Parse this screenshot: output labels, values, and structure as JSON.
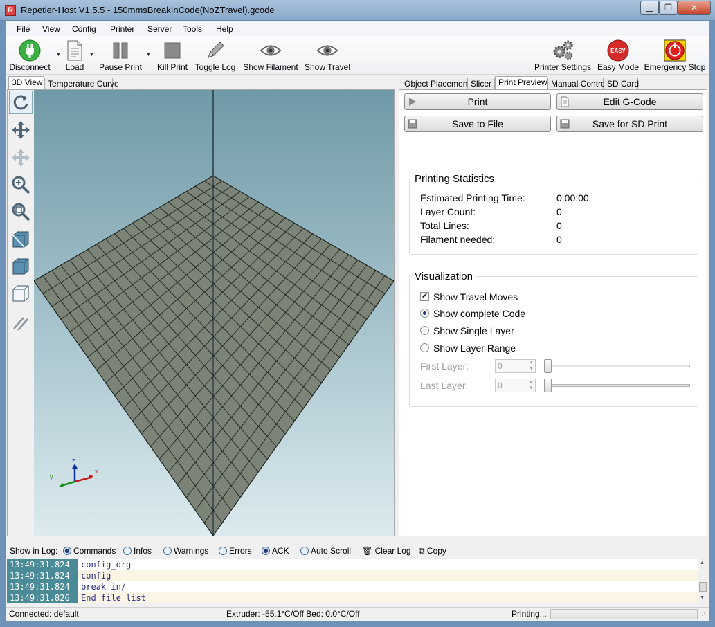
{
  "window": {
    "title": "Repetier-Host V1.5.5 - 150mmsBreakInCode(NoZTravel).gcode",
    "app_icon": "R"
  },
  "menu": [
    "File",
    "View",
    "Config",
    "Printer",
    "Server",
    "Tools",
    "Help"
  ],
  "toolbar": {
    "disconnect": "Disconnect",
    "load": "Load",
    "pause_print": "Pause Print",
    "kill_print": "Kill Print",
    "toggle_log": "Toggle Log",
    "show_filament": "Show Filament",
    "show_travel": "Show Travel",
    "printer_settings": "Printer Settings",
    "easy_mode": "Easy Mode",
    "easy_badge": "EASY",
    "emergency_stop": "Emergency Stop"
  },
  "left_tabs": [
    "3D View",
    "Temperature Curve"
  ],
  "side_tools": [
    "rotate-icon",
    "move-icon",
    "move-object-icon",
    "zoom-icon",
    "fit-view-icon",
    "view-front-icon",
    "view-top-icon",
    "view-side-icon",
    "parallel-lines-icon"
  ],
  "axes": {
    "x": "x",
    "y": "y",
    "z": "z"
  },
  "right_tabs": [
    "Object Placement",
    "Slicer",
    "Print Preview",
    "Manual Control",
    "SD Card"
  ],
  "preview": {
    "print_label": "Print",
    "edit_gcode_label": "Edit G-Code",
    "save_file_label": "Save to File",
    "save_sd_label": "Save for SD Print"
  },
  "stats": {
    "title": "Printing Statistics",
    "time_label": "Estimated Printing Time:",
    "time_value": "0:00:00",
    "layers_label": "Layer Count:",
    "layers_value": "0",
    "lines_label": "Total Lines:",
    "lines_value": "0",
    "filament_label": "Filament needed:",
    "filament_value": "0"
  },
  "viz": {
    "title": "Visualization",
    "show_travel": "Show Travel Moves",
    "show_travel_checked": true,
    "complete": "Show complete Code",
    "single": "Show Single Layer",
    "range": "Show Layer Range",
    "selected": "complete",
    "first_layer": "First Layer:",
    "first_value": "0",
    "last_layer": "Last Layer:",
    "last_value": "0"
  },
  "log": {
    "show_in_log": "Show in Log:",
    "commands": "Commands",
    "infos": "Infos",
    "warnings": "Warnings",
    "errors": "Errors",
    "ack": "ACK",
    "auto_scroll": "Auto Scroll",
    "clear_log": "Clear Log",
    "copy": "Copy",
    "rows": [
      {
        "time": "13:49:31.824",
        "msg": "config_org"
      },
      {
        "time": "13:49:31.824",
        "msg": "config"
      },
      {
        "time": "13:49:31.824",
        "msg": "break in/"
      },
      {
        "time": "13:49:31.826",
        "msg": "End file list"
      }
    ]
  },
  "status": {
    "connected": "Connected: default",
    "temps": "Extruder: -55.1°C/Off Bed: 0.0°C/Off",
    "printing": "Printing..."
  },
  "colors": {
    "accent": "#4a8b97",
    "bed": "#7c8478",
    "sky_top": "#6f9aa7",
    "sky_bottom": "#dcebef",
    "green": "#4caf50",
    "red": "#d32f2f"
  }
}
